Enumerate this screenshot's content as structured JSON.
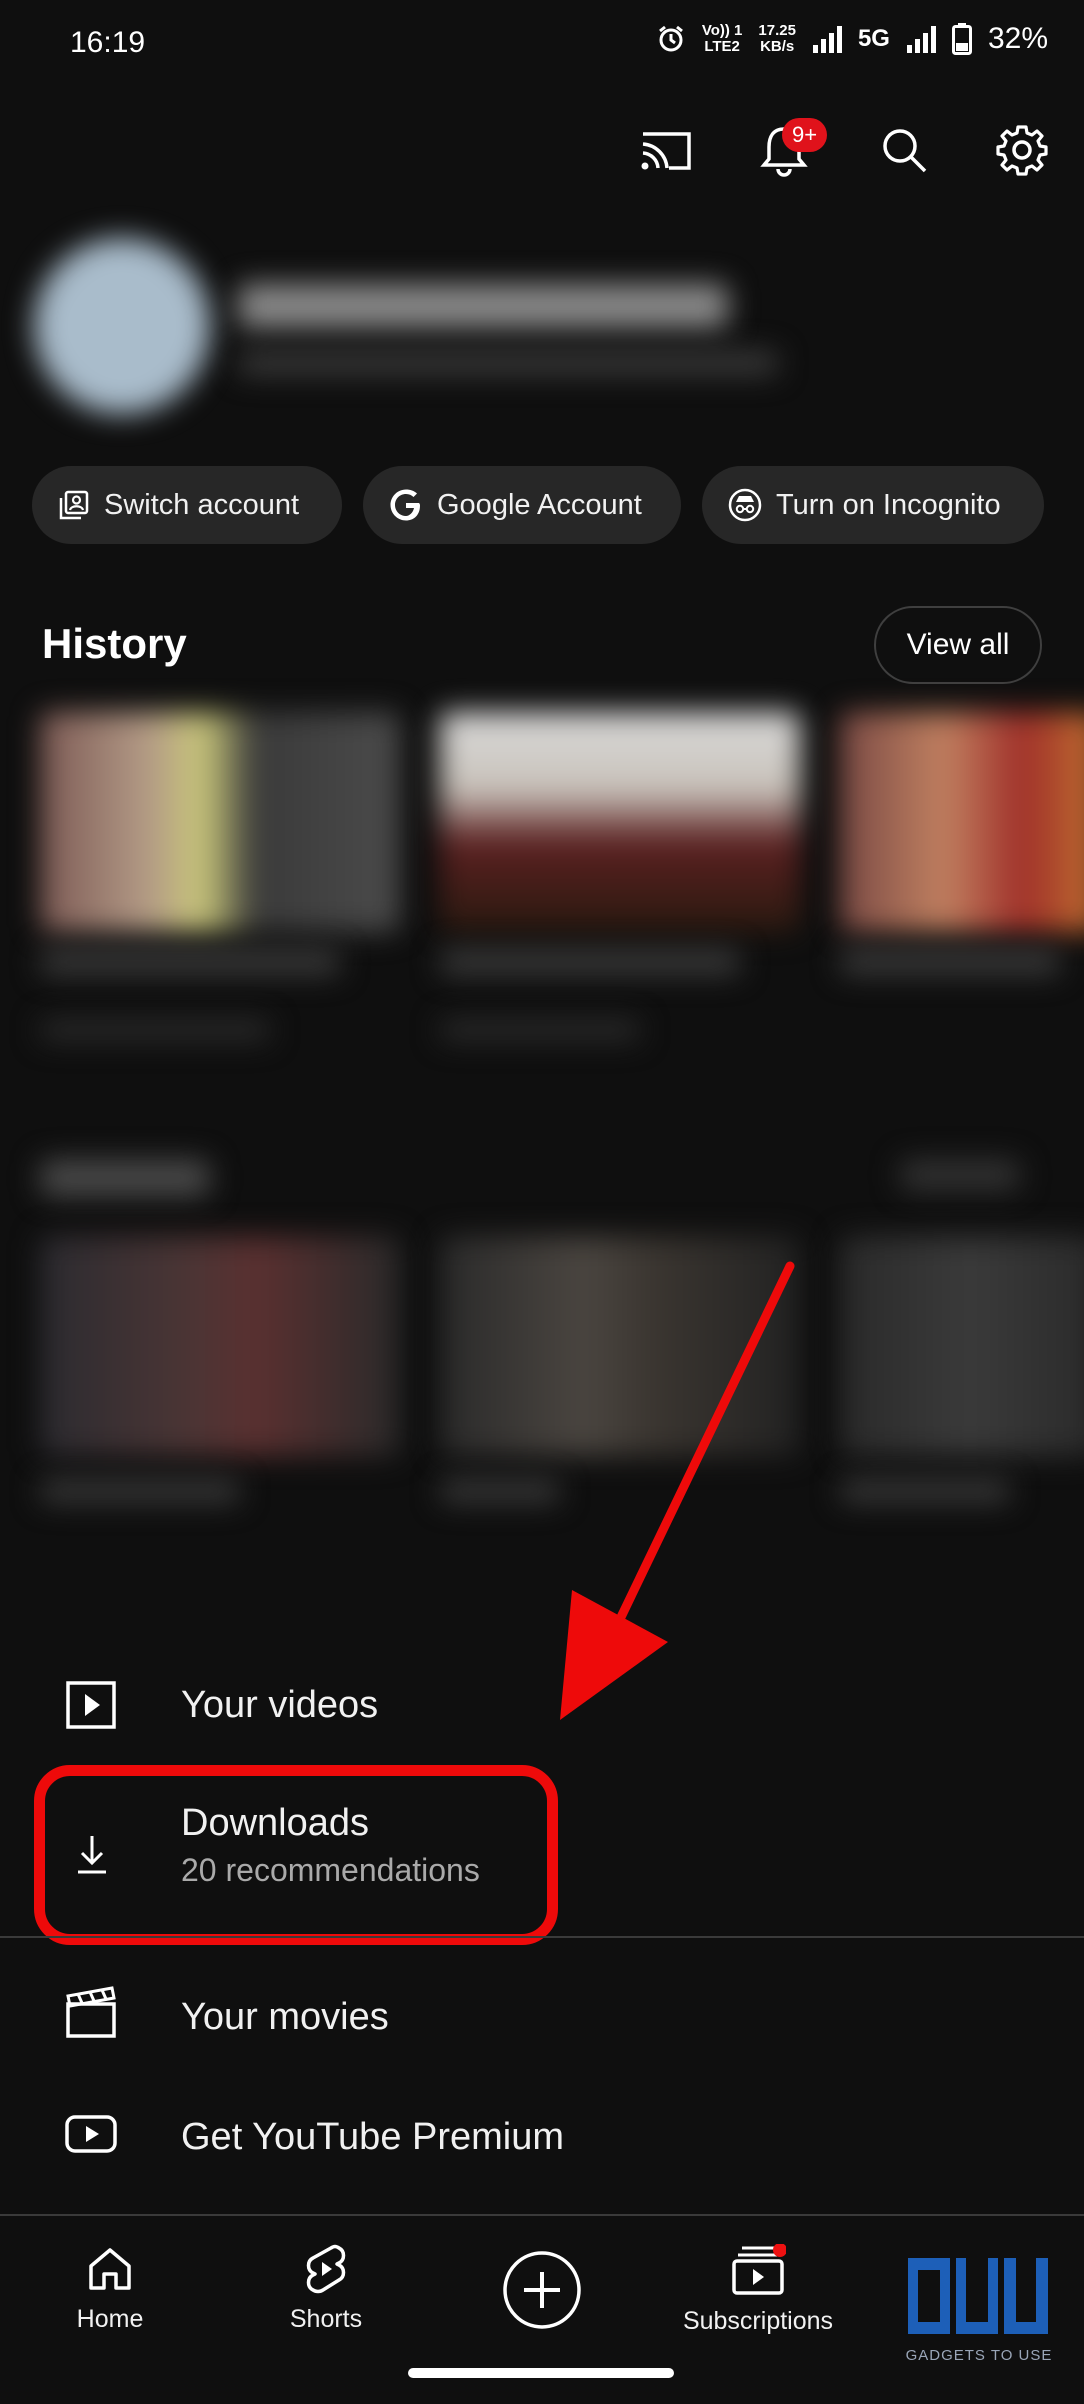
{
  "status_bar": {
    "time": "16:19",
    "net_line1": "Vo)) 1",
    "net_line2": "LTE2",
    "speed_line1": "17.25",
    "speed_line2": "KB/s",
    "network": "5G",
    "battery": "32%"
  },
  "top_bar": {
    "notification_badge": "9+"
  },
  "chips": [
    {
      "label": "Switch account",
      "icon": "switch-account-icon"
    },
    {
      "label": "Google Account",
      "icon": "google-icon"
    },
    {
      "label": "Turn on Incognito",
      "icon": "incognito-icon"
    }
  ],
  "history": {
    "title": "History",
    "view_all": "View all"
  },
  "menu": {
    "your_videos": "Your videos",
    "downloads": "Downloads",
    "downloads_sub": "20 recommendations",
    "your_movies": "Your movies",
    "premium": "Get YouTube Premium"
  },
  "nav": {
    "home": "Home",
    "shorts": "Shorts",
    "subscriptions": "Subscriptions"
  },
  "watermark": "GADGETS TO USE",
  "colors": {
    "background": "#0f0f0f",
    "chip": "#272727",
    "highlight": "#ee0a0a",
    "badge": "#e0121b"
  }
}
